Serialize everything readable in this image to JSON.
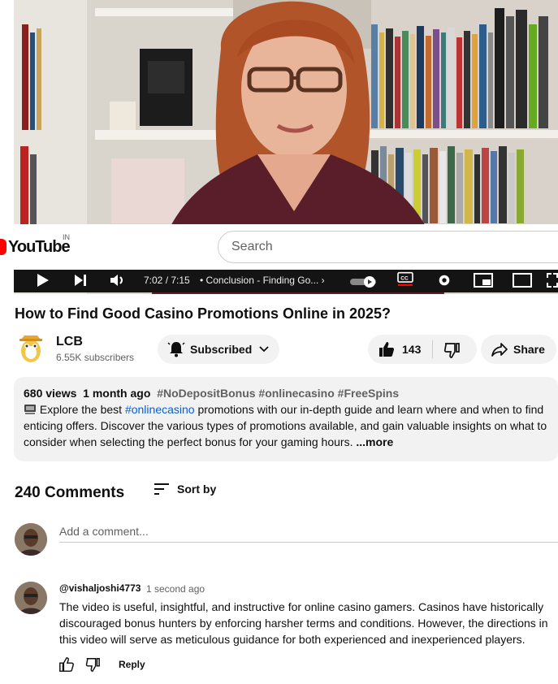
{
  "player": {
    "time": "7:02 / 7:15",
    "chapter": "• Conclusion - Finding Go...",
    "chapter_arrow": "›"
  },
  "masthead": {
    "logo_text": "YouTube",
    "country": "IN",
    "search_placeholder": "Search"
  },
  "video": {
    "title": "How to Find Good Casino Promotions Online in 2025?"
  },
  "channel": {
    "name": "LCB",
    "subscribers": "6.55K subscribers",
    "subscribed_label": "Subscribed"
  },
  "actions": {
    "likes": "143",
    "share_label": "Share"
  },
  "description": {
    "views": "680 views",
    "age": "1 month ago",
    "hashtags": "#NoDepositBonus #onlinecasino #FreeSpins",
    "text_before": "Explore the best ",
    "inline_tag": "#onlinecasino",
    "text_after": " promotions with our in-depth guide and learn where and when to find enticing offers. Discover the various types of promotions available, and gain valuable insights on what to consider when selecting the perfect bonus for your gaming hours.",
    "more_label": "...more"
  },
  "comments": {
    "count_label": "240 Comments",
    "sort_label": "Sort by",
    "add_placeholder": "Add a comment...",
    "items": [
      {
        "author": "@vishaljoshi4773",
        "time": "1 second ago",
        "text": "The video is useful, insightful, and instructive for online casino gamers. Casinos have historically discouraged bonus hunters by enforcing harsher terms and conditions. However, the directions in this video will serve as meticulous guidance for both experienced and inexperienced players.",
        "reply_label": "Reply"
      }
    ]
  },
  "colors": {
    "brand_red": "#ff0000",
    "link_blue": "#065fd4"
  }
}
